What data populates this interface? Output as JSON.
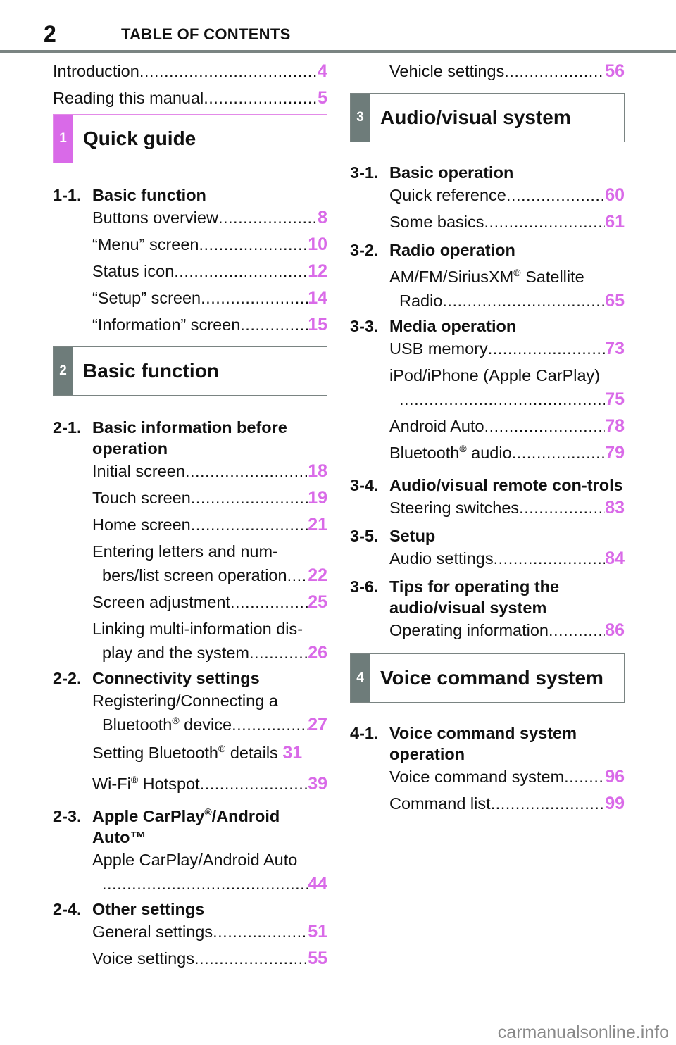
{
  "header": {
    "page_number": "2",
    "title": "TABLE OF CONTENTS"
  },
  "left": {
    "intro": [
      {
        "label": "Introduction",
        "page": "4"
      },
      {
        "label": "Reading this manual",
        "page": "5"
      }
    ],
    "section1": {
      "num": "1",
      "title": "Quick guide"
    },
    "h1_1": {
      "num": "1-1.",
      "title": "Basic function"
    },
    "items1_1": [
      {
        "label": "Buttons overview",
        "page": "8"
      },
      {
        "label": "“Menu” screen",
        "page": "10"
      },
      {
        "label": "Status icon",
        "page": "12"
      },
      {
        "label": "“Setup” screen",
        "page": "14"
      },
      {
        "label": "“Information” screen",
        "page": "15"
      }
    ],
    "section2": {
      "num": "2",
      "title": "Basic function"
    },
    "h2_1": {
      "num": "2-1.",
      "title": "Basic information before operation"
    },
    "items2_1": [
      {
        "label": "Initial screen",
        "page": "18"
      },
      {
        "label": "Touch screen",
        "page": "19"
      },
      {
        "label": "Home screen",
        "page": "21"
      }
    ],
    "entering": {
      "line1": "Entering letters and num-",
      "line2": "bers/list screen operation",
      "page": "22"
    },
    "screen_adj": {
      "label": "Screen adjustment",
      "page": "25"
    },
    "linking": {
      "line1": "Linking multi-information dis-",
      "line2": "play and the system",
      "page": "26"
    },
    "h2_2": {
      "num": "2-2.",
      "title": "Connectivity settings"
    },
    "registering": {
      "line1": "Registering/Connecting a",
      "line2a": "Bluetooth",
      "line2b": " device",
      "page": "27"
    },
    "setting_bt": {
      "a": "Setting Bluetooth",
      "b": " details",
      "page": "31"
    },
    "wifi": {
      "a": "Wi-Fi",
      "b": " Hotspot",
      "page": "39"
    },
    "h2_3": {
      "num": "2-3.",
      "a": "Apple CarPlay",
      "b": "/Android Auto™"
    },
    "carplay": {
      "line1": "Apple CarPlay/Android Auto",
      "page": "44"
    },
    "h2_4": {
      "num": "2-4.",
      "title": "Other settings"
    },
    "items2_4": [
      {
        "label": "General settings",
        "page": "51"
      },
      {
        "label": "Voice settings",
        "page": "55"
      }
    ],
    "reg_mark": "®"
  },
  "right": {
    "vehicle": {
      "label": "Vehicle settings",
      "page": "56"
    },
    "section3": {
      "num": "3",
      "title": "Audio/visual system"
    },
    "h3_1": {
      "num": "3-1.",
      "title": "Basic operation"
    },
    "items3_1": [
      {
        "label": "Quick reference",
        "page": "60"
      },
      {
        "label": "Some basics",
        "page": "61"
      }
    ],
    "h3_2": {
      "num": "3-2.",
      "title": "Radio operation"
    },
    "radio": {
      "a": "AM/FM/SiriusXM",
      "b": " Satellite",
      "line2": "Radio",
      "page": "65"
    },
    "h3_3": {
      "num": "3-3.",
      "title": "Media operation"
    },
    "usb": {
      "label": "USB memory",
      "page": "73"
    },
    "ipod": {
      "line1": "iPod/iPhone (Apple CarPlay)",
      "page": "75"
    },
    "android": {
      "label": "Android Auto",
      "page": "78"
    },
    "bt_audio": {
      "a": "Bluetooth",
      "b": " audio",
      "page": "79"
    },
    "h3_4": {
      "num": "3-4.",
      "title": "Audio/visual remote con-trols"
    },
    "steering": {
      "label": "Steering switches",
      "page": "83"
    },
    "h3_5": {
      "num": "3-5.",
      "title": "Setup"
    },
    "audio_settings": {
      "label": "Audio settings",
      "page": "84"
    },
    "h3_6": {
      "num": "3-6.",
      "title": "Tips for operating the audio/visual system"
    },
    "op_info": {
      "label": "Operating information",
      "page": "86"
    },
    "section4": {
      "num": "4",
      "title": "Voice command system"
    },
    "h4_1": {
      "num": "4-1.",
      "title": "Voice command system operation"
    },
    "items4_1": [
      {
        "label": "Voice command system",
        "page": "96"
      },
      {
        "label": "Command list",
        "page": "99"
      }
    ],
    "reg_mark": "®"
  },
  "footer": {
    "watermark": "carmanualsonline.info"
  },
  "colors": {
    "accent_pink": "#d96ae8",
    "section_gray": "#6e7c7a"
  }
}
